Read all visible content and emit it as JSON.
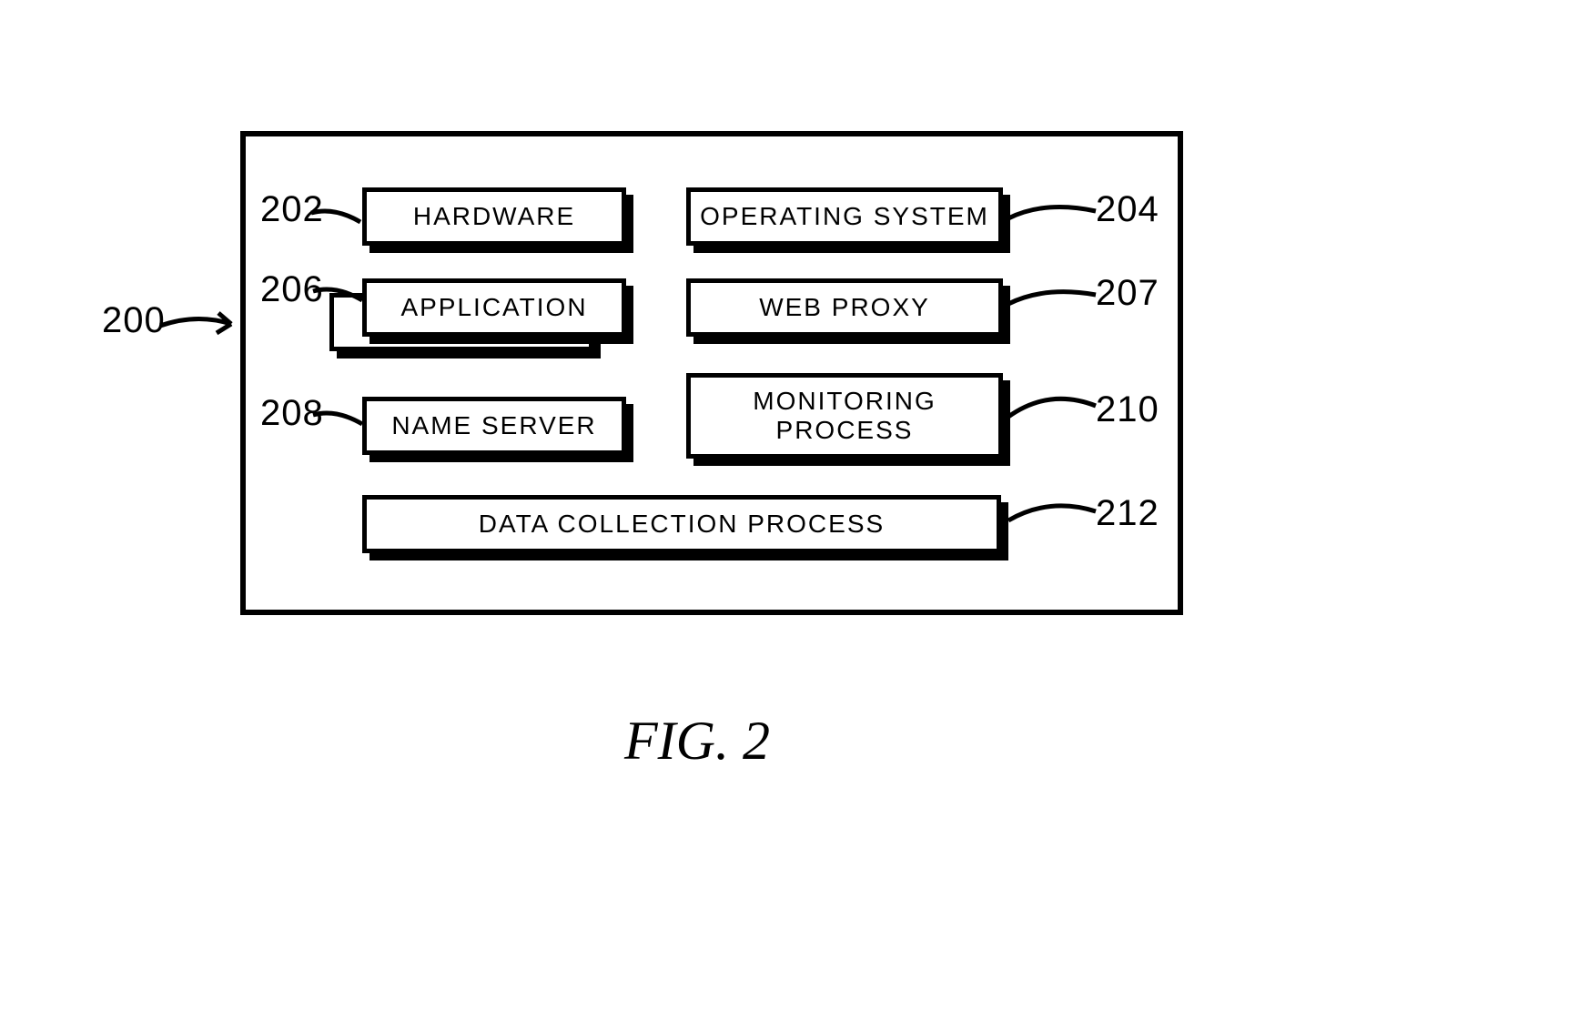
{
  "figure": {
    "caption": "FIG. 2",
    "main_ref": "200",
    "blocks": {
      "hardware": {
        "label": "HARDWARE",
        "ref": "202"
      },
      "os": {
        "label": "OPERATING SYSTEM",
        "ref": "204"
      },
      "app": {
        "label": "APPLICATION",
        "ref": "206"
      },
      "webproxy": {
        "label": "WEB PROXY",
        "ref": "207"
      },
      "nameserver": {
        "label": "NAME SERVER",
        "ref": "208"
      },
      "monitor": {
        "label": "MONITORING PROCESS",
        "ref": "210"
      },
      "datacoll": {
        "label": "DATA COLLECTION PROCESS",
        "ref": "212"
      }
    }
  }
}
